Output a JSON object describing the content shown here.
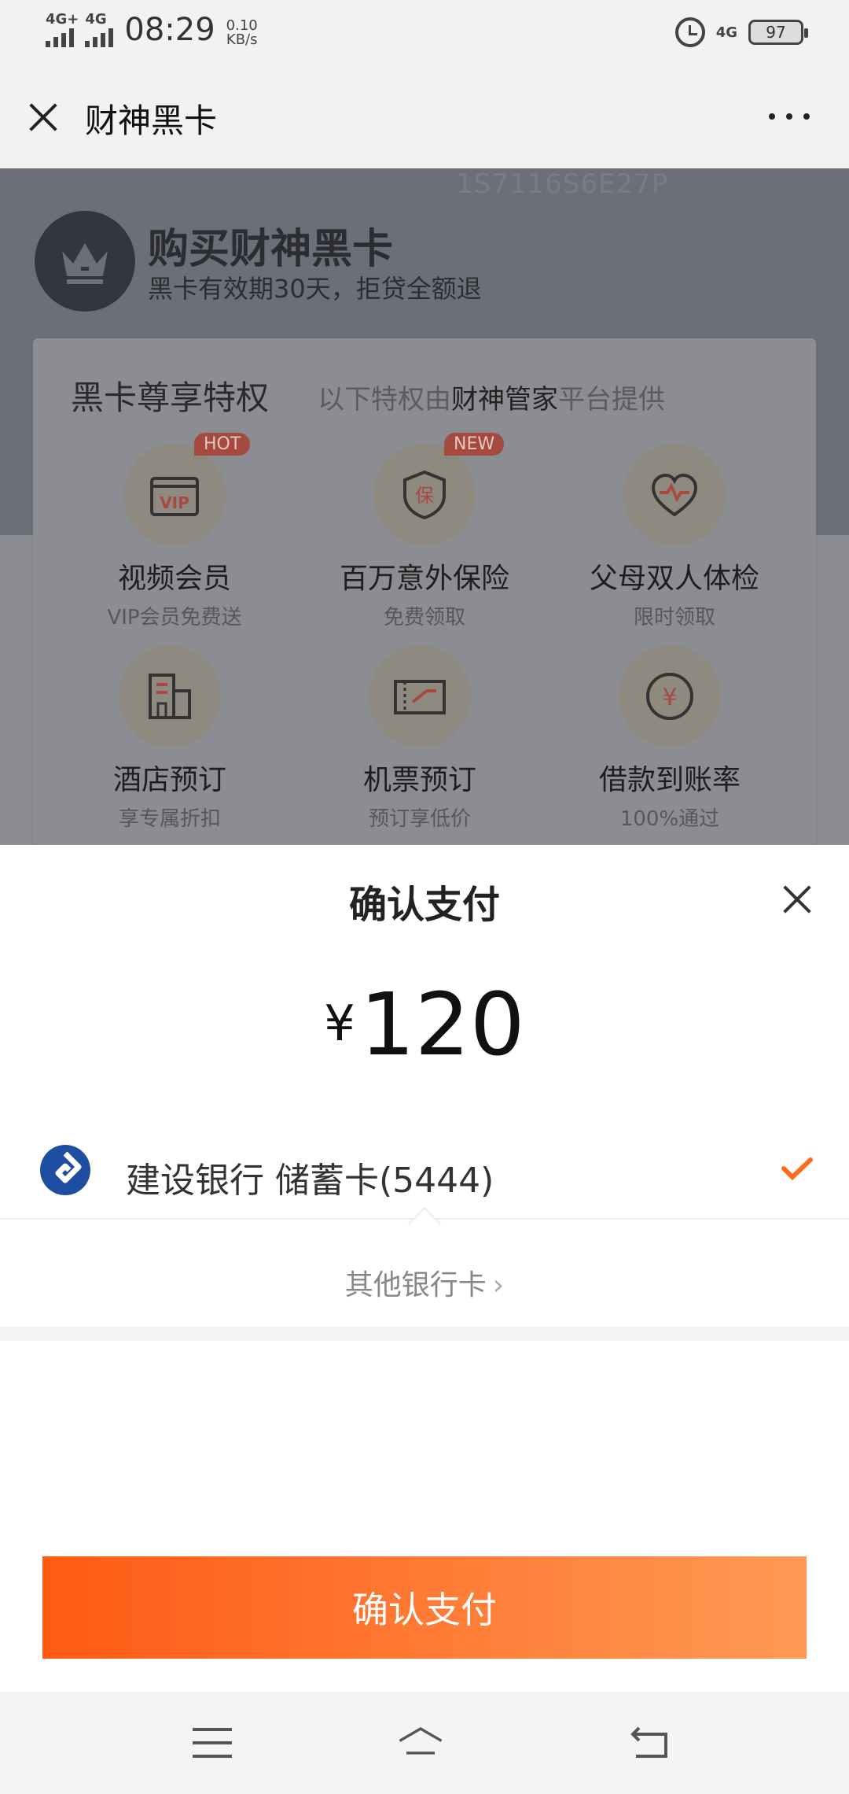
{
  "status_bar": {
    "signal_1": "4G+",
    "signal_2": "4G",
    "time": "08:29",
    "speed_value": "0.10",
    "speed_unit": "KB/s",
    "net_right": "4G",
    "battery": "97"
  },
  "title_bar": {
    "title": "财神黑卡"
  },
  "background_page": {
    "serial": "1S7116S6E27P",
    "hero_title": "购买财神黑卡",
    "hero_subtitle": "黑卡有效期30天，拒贷全额退",
    "card_title": "黑卡尊享特权",
    "card_note_prefix": "以下特权由",
    "card_note_brand": "财神管家",
    "card_note_suffix": "平台提供",
    "perks": [
      {
        "name": "视频会员",
        "sub": "VIP会员免费送",
        "tag": "HOT",
        "icon": "vip-ticket-icon"
      },
      {
        "name": "百万意外保险",
        "sub": "免费领取",
        "tag": "NEW",
        "icon": "shield-icon"
      },
      {
        "name": "父母双人体检",
        "sub": "限时领取",
        "tag": "",
        "icon": "heart-pulse-icon"
      },
      {
        "name": "酒店预订",
        "sub": "享专属折扣",
        "tag": "",
        "icon": "hotel-icon"
      },
      {
        "name": "机票预订",
        "sub": "预订享低价",
        "tag": "",
        "icon": "ticket-icon"
      },
      {
        "name": "借款到账率",
        "sub": "100%通过",
        "tag": "",
        "icon": "yen-coin-icon"
      }
    ]
  },
  "payment_sheet": {
    "title": "确认支付",
    "currency": "¥",
    "amount": "120",
    "bank": "建设银行 储蓄卡(5444)",
    "other_bank": "其他银行卡",
    "confirm_button": "确认支付"
  },
  "colors": {
    "accent": "#ff6a1f",
    "button_start": "#ff5a14",
    "button_end": "#ff9a54",
    "bank_logo": "#1d4ea1"
  }
}
